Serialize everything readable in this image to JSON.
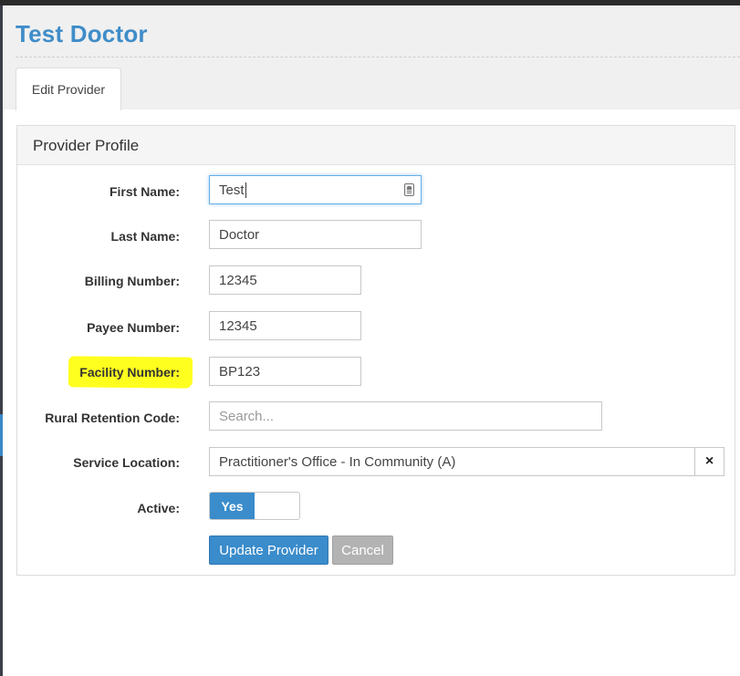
{
  "header": {
    "title": "Test Doctor"
  },
  "tabs": [
    {
      "label": "Edit Provider"
    }
  ],
  "panel": {
    "title": "Provider Profile"
  },
  "form": {
    "first_name": {
      "label": "First Name:",
      "value": "Test"
    },
    "last_name": {
      "label": "Last Name:",
      "value": "Doctor"
    },
    "billing_number": {
      "label": "Billing Number:",
      "value": "12345"
    },
    "payee_number": {
      "label": "Payee Number:",
      "value": "12345"
    },
    "facility_number": {
      "label": "Facility Number:",
      "value": "BP123"
    },
    "rural_retention_code": {
      "label": "Rural Retention Code:",
      "value": "",
      "placeholder": "Search..."
    },
    "service_location": {
      "label": "Service Location:",
      "value": "Practitioner's Office - In Community (A)",
      "clear_icon": "×"
    },
    "active": {
      "label": "Active:",
      "value": "Yes"
    }
  },
  "actions": {
    "update_label": "Update Provider",
    "cancel_label": "Cancel"
  },
  "colors": {
    "accent": "#3a8ccb",
    "title": "#3f8dc9",
    "highlight": "#ffff1f",
    "cancel": "#b3b3b3"
  }
}
